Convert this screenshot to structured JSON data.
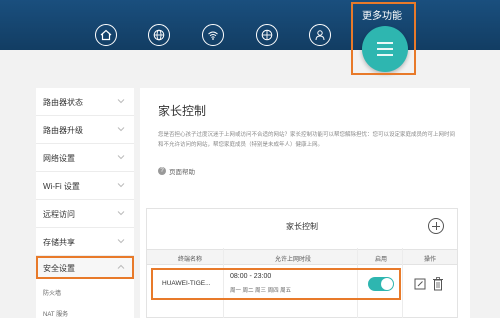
{
  "topbar": {
    "more_label": "更多功能",
    "icons": [
      "home-icon",
      "globe-icon",
      "wifi-icon",
      "network-icon",
      "user-icon"
    ],
    "more_button_icon": "menu-icon"
  },
  "sidebar": {
    "items": [
      {
        "label": "路由器状态"
      },
      {
        "label": "路由器升级"
      },
      {
        "label": "网络设置"
      },
      {
        "label": "Wi-Fi 设置"
      },
      {
        "label": "远程访问"
      },
      {
        "label": "存储共享"
      },
      {
        "label": "安全设置"
      }
    ],
    "sub_items": [
      "防火墙",
      "NAT 服务"
    ]
  },
  "main": {
    "title": "家长控制",
    "description": "您是否担心孩子过度沉迷于上网或访问不合适的网站？家长控制功能可以帮您解除担忧：您可以设定家庭成员的可上网时间和不允许访问的网站，帮您家庭成员（特别是未成年人）健康上网。",
    "help": "页面帮助"
  },
  "table": {
    "title": "家长控制",
    "headers": [
      "终端名称",
      "允许上网时段",
      "启用",
      "操作"
    ],
    "rows": [
      {
        "name": "HUAWEI-TIGE...",
        "time": "08:00 - 23:00",
        "days": "周一 周二 周三 周四 周五",
        "enabled": true
      }
    ]
  },
  "colors": {
    "accent": "#2eb6b0",
    "topbar": "#123d63",
    "highlight": "#e87a2a"
  }
}
